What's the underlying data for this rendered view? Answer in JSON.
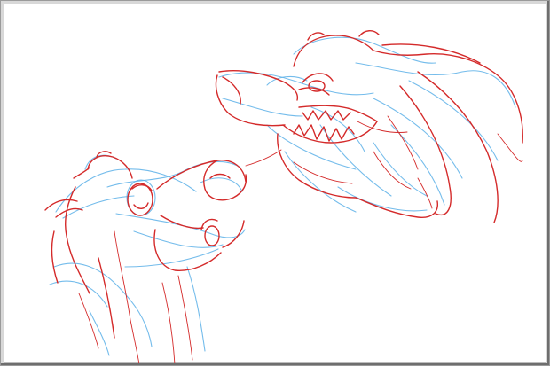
{
  "image": {
    "subject": "pencil-sketch",
    "ink_colors": {
      "construction": "#5cb0e8",
      "linework": "#d42a2a",
      "paper": "#ffffff",
      "frame": "#9a9a9a"
    }
  }
}
